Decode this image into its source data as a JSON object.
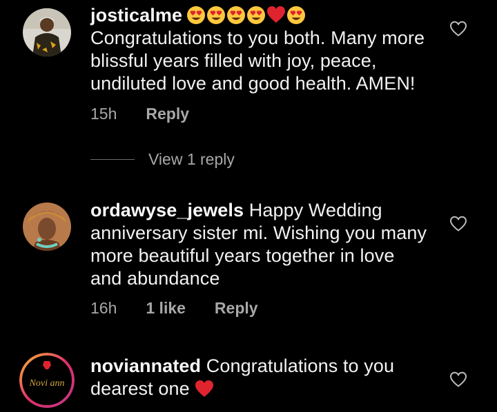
{
  "comments": [
    {
      "username": "josticalme",
      "emojis": [
        "heart-eyes",
        "heart-eyes",
        "heart-eyes",
        "heart-eyes",
        "red-heart",
        "heart-eyes"
      ],
      "line1": "Congratulations to you both. Many more",
      "line2": "blissful years filled with joy, peace,",
      "line3": "undiluted love and good health. AMEN!",
      "time": "15h",
      "reply_label": "Reply",
      "view_replies": "View 1 reply"
    },
    {
      "username": "ordawyse_jewels",
      "line1_rest": "Happy Wedding",
      "line2": "anniversary sister mi. Wishing you many",
      "line3": "more beautiful years together in love",
      "line4": "and abundance",
      "time": "16h",
      "likes": "1 like",
      "reply_label": "Reply"
    },
    {
      "username": "noviannated",
      "line1_rest": "Congratulations to you",
      "line2": "dearest one",
      "trailing_emoji": "red-heart",
      "logo_text": "Novi ann"
    }
  ],
  "colors": {
    "background": "#000000",
    "text": "#f2f2f2",
    "secondary": "#a8a8a8",
    "heart": "#e0242f",
    "emoji_face": "#ffc83d"
  }
}
